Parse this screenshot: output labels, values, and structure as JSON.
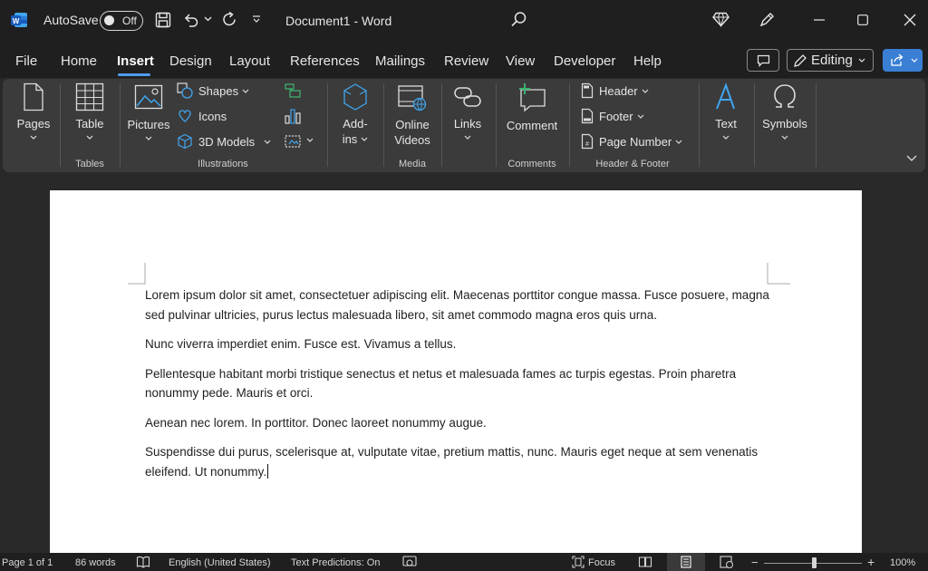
{
  "titlebar": {
    "autosave_label": "AutoSave",
    "autosave_state": "Off",
    "doc_title": "Document1  -  Word"
  },
  "menubar": {
    "tabs": [
      "File",
      "Home",
      "Insert",
      "Design",
      "Layout",
      "References",
      "Mailings",
      "Review",
      "View",
      "Developer",
      "Help"
    ],
    "active_tab": "Insert",
    "editing_label": "Editing",
    "accent_color": "#4f9cf0"
  },
  "ribbon": {
    "pages": "Pages",
    "table": "Table",
    "tables_group": "Tables",
    "pictures": "Pictures",
    "shapes": "Shapes",
    "icons": "Icons",
    "models3d": "3D Models",
    "illustrations_group": "Illustrations",
    "addins_line1": "Add-",
    "addins_line2": "ins",
    "online_videos_line1": "Online",
    "online_videos_line2": "Videos",
    "media_group": "Media",
    "links": "Links",
    "comment": "Comment",
    "comments_group": "Comments",
    "header": "Header",
    "footer": "Footer",
    "page_number": "Page Number",
    "header_footer_group": "Header & Footer",
    "text": "Text",
    "symbols": "Symbols"
  },
  "document": {
    "paragraphs": [
      "Lorem ipsum dolor sit amet, consectetuer adipiscing elit. Maecenas porttitor congue massa. Fusce posuere, magna sed pulvinar ultricies, purus lectus malesuada libero, sit amet commodo magna eros quis urna.",
      "Nunc viverra imperdiet enim. Fusce est. Vivamus a tellus.",
      "Pellentesque habitant morbi tristique senectus et netus et malesuada fames ac turpis egestas. Proin pharetra nonummy pede. Mauris et orci.",
      "Aenean nec lorem. In porttitor. Donec laoreet nonummy augue.",
      "Suspendisse dui purus, scelerisque at, vulputate vitae, pretium mattis, nunc. Mauris eget neque at sem venenatis eleifend. Ut nonummy."
    ]
  },
  "statusbar": {
    "page": "Page 1 of 1",
    "words": "86 words",
    "language": "English (United States)",
    "predictions": "Text Predictions: On",
    "focus": "Focus",
    "zoom_minus": "−",
    "zoom_plus": "+",
    "zoom": "100%"
  }
}
